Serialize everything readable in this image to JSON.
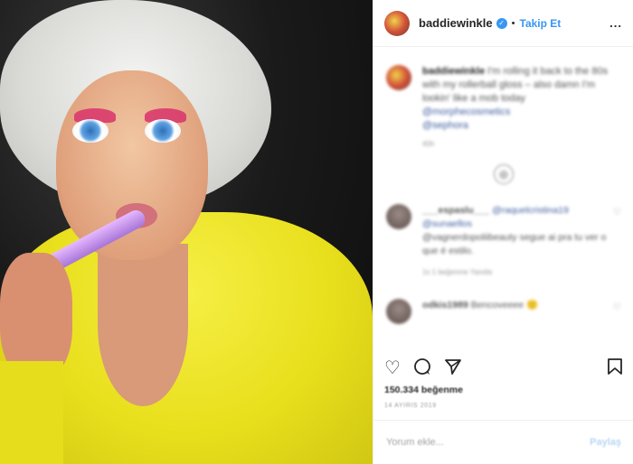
{
  "header": {
    "username": "baddiewinkle",
    "verified_icon": "check-badge-icon",
    "separator": "•",
    "follow_label": "Takip Et",
    "more_label": "..."
  },
  "caption": {
    "username": "baddiewinkle",
    "text": "I'm rolling it back to the 80s with my rollerball gloss – also damn I'm lookin' like a mob today",
    "mention1": "@morphecosmetics",
    "mention2": "@sephora",
    "time": "40h"
  },
  "comments": [
    {
      "username": "___espaslu___",
      "text_prefix": "@raquelcristina19",
      "mention": "@sunaellos",
      "body": "@vagnerdopoliibeauty segue ai pra tu ver o que é estilo.",
      "meta": "1s   1 beğenme   Yanıtla"
    },
    {
      "username": "odkis1989",
      "body": "Bencoveeee 🙂"
    }
  ],
  "actions": {
    "like_icon": "heart-icon",
    "comment_icon": "comment-bubble-icon",
    "share_icon": "send-icon",
    "save_icon": "bookmark-icon"
  },
  "likes": "150.334 beğenme",
  "date": "14 AYIRIS 2019",
  "add_comment": {
    "placeholder": "Yorum ekle...",
    "post_label": "Paylaş"
  }
}
